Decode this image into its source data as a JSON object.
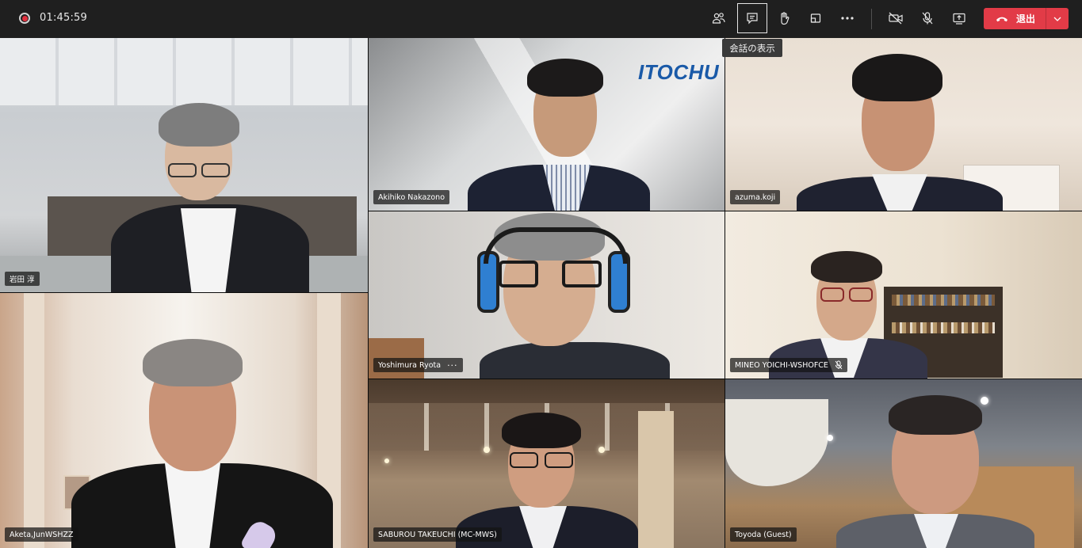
{
  "topbar": {
    "timer": "01:45:59",
    "tooltip": "会話の表示",
    "leave_label": "退出",
    "icons": [
      "participants-icon",
      "chat-icon",
      "raise-hand-icon",
      "share-tray-icon",
      "more-options-icon",
      "camera-off-icon",
      "mic-off-icon",
      "share-screen-icon",
      "hang-up-icon",
      "chevron-down-icon"
    ],
    "colors": {
      "bar": "#1f1f1f",
      "leave": "#e23b47",
      "record": "#e0303e"
    }
  },
  "logo_text": "ITOCHU",
  "participants": [
    {
      "name": "岩田 淳"
    },
    {
      "name": "Akihiko Nakazono"
    },
    {
      "name": "azuma.koji"
    },
    {
      "name": "Yoshimura Ryota",
      "extra": "···"
    },
    {
      "name": "MINEO YOICHI-WSHOFCE"
    },
    {
      "name": "Aketa,JunWSHZZ"
    },
    {
      "name": "SABUROU TAKEUCHI (MC-MWS)"
    },
    {
      "name": "Toyoda (Guest)"
    }
  ]
}
